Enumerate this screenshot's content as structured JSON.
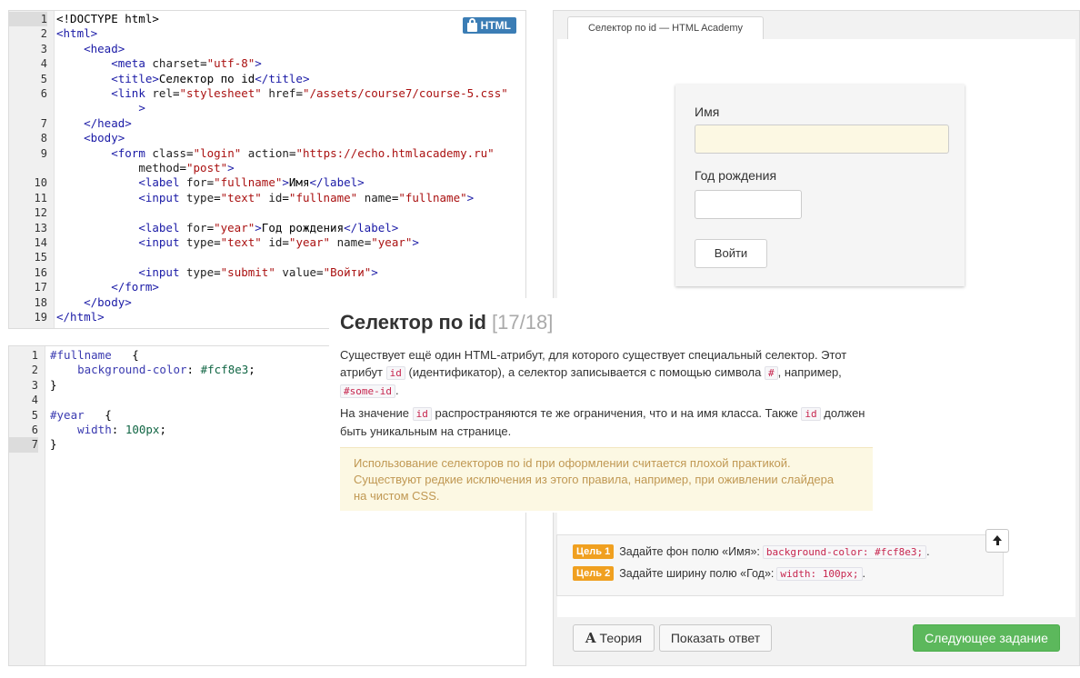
{
  "html_editor": {
    "badge": "HTML",
    "lines": [
      {
        "n": "1",
        "html": "<span class=\"plain\">&lt;!DOCTYPE html&gt;</span>"
      },
      {
        "n": "2",
        "html": "<span class=\"tg\">&lt;html&gt;</span>"
      },
      {
        "n": "3",
        "html": "    <span class=\"tg\">&lt;head&gt;</span>"
      },
      {
        "n": "4",
        "html": "        <span class=\"tg\">&lt;meta</span> <span class=\"at\">charset</span>=<span class=\"st\">\"utf-8\"</span><span class=\"tg\">&gt;</span>"
      },
      {
        "n": "5",
        "html": "        <span class=\"tg\">&lt;title&gt;</span>Селектор по id<span class=\"tg\">&lt;/title&gt;</span>"
      },
      {
        "n": "6",
        "html": "        <span class=\"tg\">&lt;link</span> <span class=\"at\">rel</span>=<span class=\"st\">\"stylesheet\"</span> <span class=\"at\">href</span>=<span class=\"st\">\"/assets/course7/course-5.css\"</span>"
      },
      {
        "n": "",
        "html": "            <span class=\"tg\">&gt;</span>"
      },
      {
        "n": "7",
        "html": "    <span class=\"tg\">&lt;/head&gt;</span>"
      },
      {
        "n": "8",
        "html": "    <span class=\"tg\">&lt;body&gt;</span>"
      },
      {
        "n": "9",
        "html": "        <span class=\"tg\">&lt;form</span> <span class=\"at\">class</span>=<span class=\"st\">\"login\"</span> <span class=\"at\">action</span>=<span class=\"st\">\"https://echo.htmlacademy.ru\"</span>"
      },
      {
        "n": "",
        "html": "            <span class=\"at\">method</span>=<span class=\"st\">\"post\"</span><span class=\"tg\">&gt;</span>"
      },
      {
        "n": "10",
        "html": "            <span class=\"tg\">&lt;label</span> <span class=\"at\">for</span>=<span class=\"st\">\"fullname\"</span><span class=\"tg\">&gt;</span>Имя<span class=\"tg\">&lt;/label&gt;</span>"
      },
      {
        "n": "11",
        "html": "            <span class=\"tg\">&lt;input</span> <span class=\"at\">type</span>=<span class=\"st\">\"text\"</span> <span class=\"at\">id</span>=<span class=\"st\">\"fullname\"</span> <span class=\"at\">name</span>=<span class=\"st\">\"fullname\"</span><span class=\"tg\">&gt;</span>"
      },
      {
        "n": "12",
        "html": ""
      },
      {
        "n": "13",
        "html": "            <span class=\"tg\">&lt;label</span> <span class=\"at\">for</span>=<span class=\"st\">\"year\"</span><span class=\"tg\">&gt;</span>Год рождения<span class=\"tg\">&lt;/label&gt;</span>"
      },
      {
        "n": "14",
        "html": "            <span class=\"tg\">&lt;input</span> <span class=\"at\">type</span>=<span class=\"st\">\"text\"</span> <span class=\"at\">id</span>=<span class=\"st\">\"year\"</span> <span class=\"at\">name</span>=<span class=\"st\">\"year\"</span><span class=\"tg\">&gt;</span>"
      },
      {
        "n": "15",
        "html": ""
      },
      {
        "n": "16",
        "html": "            <span class=\"tg\">&lt;input</span> <span class=\"at\">type</span>=<span class=\"st\">\"submit\"</span> <span class=\"at\">value</span>=<span class=\"st\">\"Войти\"</span><span class=\"tg\">&gt;</span>"
      },
      {
        "n": "17",
        "html": "        <span class=\"tg\">&lt;/form&gt;</span>"
      },
      {
        "n": "18",
        "html": "    <span class=\"tg\">&lt;/body&gt;</span>"
      },
      {
        "n": "19",
        "html": "<span class=\"tg\">&lt;/html&gt;</span>"
      }
    ]
  },
  "css_editor": {
    "lines": [
      {
        "n": "1",
        "html": "<span class=\"sel\">#fullname</span>   {"
      },
      {
        "n": "2",
        "html": "    <span class=\"prop\">background-color</span>: <span class=\"val\">#fcf8e3</span>;"
      },
      {
        "n": "3",
        "html": "}"
      },
      {
        "n": "4",
        "html": ""
      },
      {
        "n": "5",
        "html": "<span class=\"sel\">#year</span>   {"
      },
      {
        "n": "6",
        "html": "    <span class=\"prop\">width</span>: <span class=\"num\">100px</span>;"
      },
      {
        "n": "7",
        "html": "}"
      }
    ]
  },
  "preview": {
    "tab_title": "Селектор по id — HTML Academy",
    "label_name": "Имя",
    "label_year": "Год рождения",
    "submit": "Войти",
    "name_bg": "#fcf8e3"
  },
  "theory": {
    "title": "Селектор по id",
    "counter": "[17/18]",
    "p1_a": "Существует ещё один HTML-атрибут, для которого существует специальный селектор. Этот атрибут",
    "p1_code1": "id",
    "p1_b": "(идентификатор), а селектор записывается с помощью символа",
    "p1_code2": "#",
    "p1_c": ", например,",
    "p1_code3": "#some-id",
    "p1_d": ".",
    "p2_a": "На значение",
    "p2_code1": "id",
    "p2_b": "распространяются те же ограничения, что и на имя класса. Также",
    "p2_code2": "id",
    "p2_c": "должен быть уникальным на странице.",
    "warning_line1": "Использование селекторов по id при оформлении считается плохой практикой.",
    "warning_line2": "Существуют редкие исключения из этого правила, например, при оживлении слайдера",
    "warning_line3": "на чистом CSS."
  },
  "goals": [
    {
      "badge": "Цель 1",
      "text": "Задайте фон полю «Имя»:",
      "code": "background-color: #fcf8e3;",
      "end": "."
    },
    {
      "badge": "Цель 2",
      "text": "Задайте ширину полю «Год»:",
      "code": "width: 100px;",
      "end": "."
    }
  ],
  "buttons": {
    "theory_icon": "A",
    "theory": "Теория",
    "show_answer": "Показать ответ",
    "next": "Следующее задание"
  },
  "colors": {
    "accent_blue": "#3b7db5",
    "goal_orange": "#f0a020",
    "next_green": "#5cb85c",
    "warning_bg": "#fcf8e3"
  }
}
